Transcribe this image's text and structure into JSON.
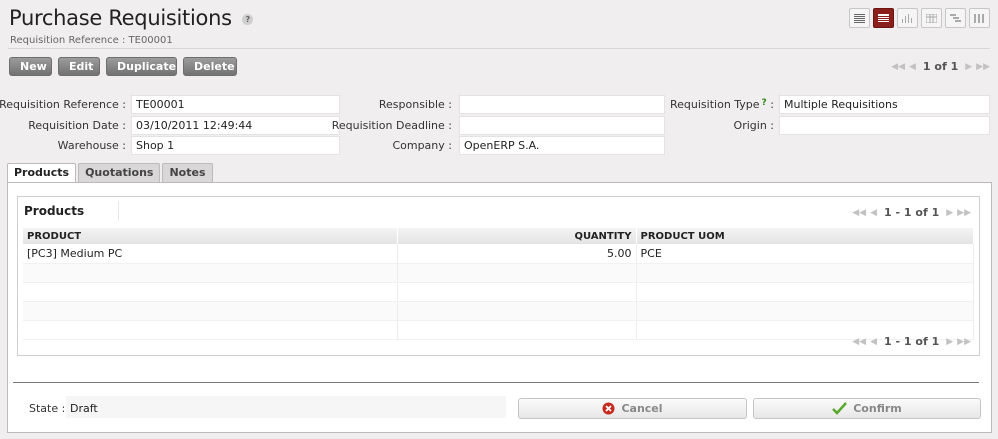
{
  "header": {
    "title": "Purchase Requisitions",
    "help": "?",
    "subtitle": "Requisition Reference : TE00001"
  },
  "view_switch": {
    "items": [
      {
        "icon": "list-view-icon",
        "active": false
      },
      {
        "icon": "form-view-icon",
        "active": true
      },
      {
        "icon": "graph-view-icon",
        "active": false
      },
      {
        "icon": "calendar-view-icon",
        "active": false
      },
      {
        "icon": "gantt-view-icon",
        "active": false
      },
      {
        "icon": "kanban-view-icon",
        "active": false
      }
    ]
  },
  "toolbar": {
    "new_label": "New",
    "edit_label": "Edit",
    "duplicate_label": "Duplicate",
    "delete_label": "Delete"
  },
  "record_pager": {
    "count": "1 of 1"
  },
  "form": {
    "requisition_reference": {
      "label": "Requisition Reference :",
      "value": "TE00001"
    },
    "requisition_date": {
      "label": "Requisition Date :",
      "value": "03/10/2011 12:49:44"
    },
    "warehouse": {
      "label": "Warehouse :",
      "value": "Shop 1"
    },
    "responsible": {
      "label": "Responsible :",
      "value": ""
    },
    "requisition_deadline": {
      "label": "Requisition Deadline :",
      "value": ""
    },
    "company": {
      "label": "Company :",
      "value": "OpenERP S.A."
    },
    "requisition_type": {
      "label": "Requisition Type",
      "help": "?",
      "colon": ":",
      "value": "Multiple Requisitions"
    },
    "origin": {
      "label": "Origin :",
      "value": ""
    }
  },
  "tabs": [
    {
      "label": "Products",
      "active": true
    },
    {
      "label": "Quotations",
      "active": false
    },
    {
      "label": "Notes",
      "active": false
    }
  ],
  "products_grid": {
    "title": "Products",
    "pager": "1 - 1 of 1",
    "columns": [
      "PRODUCT",
      "QUANTITY",
      "PRODUCT UOM"
    ],
    "rows": [
      [
        "[PC3] Medium PC",
        "5.00",
        "PCE"
      ]
    ],
    "bottom_pager": "1 - 1 of 1"
  },
  "footer": {
    "state_label": "State :",
    "state_value": "Draft",
    "cancel_label": "Cancel",
    "confirm_label": "Confirm"
  },
  "colors": {
    "active_view": "#8a1f1b",
    "cancel_icon": "#c62a1f",
    "confirm_icon": "#5aa82a"
  }
}
